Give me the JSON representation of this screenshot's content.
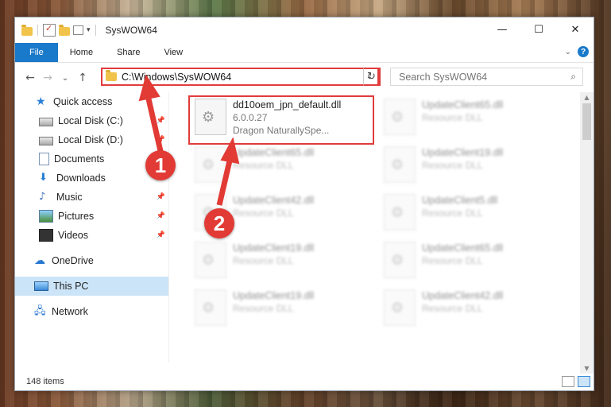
{
  "window": {
    "title": "SysWOW64",
    "controls": {
      "minimize": "—",
      "maximize": "☐",
      "close": "✕"
    }
  },
  "ribbon": {
    "tabs": [
      "File",
      "Home",
      "Share",
      "View"
    ],
    "help": "?"
  },
  "nav": {
    "back": "←",
    "forward": "→",
    "recent": "⌄",
    "up": "↑",
    "address": "C:\\Windows\\SysWOW64",
    "refresh": "↻",
    "search_placeholder": "Search SysWOW64"
  },
  "sidebar": {
    "items": [
      {
        "label": "Quick access",
        "icon": "star-icon",
        "pinned": false
      },
      {
        "label": "Local Disk (C:)",
        "icon": "disk-icon",
        "pinned": true
      },
      {
        "label": "Local Disk (D:)",
        "icon": "disk-icon",
        "pinned": true
      },
      {
        "label": "Documents",
        "icon": "documents-icon",
        "pinned": true
      },
      {
        "label": "Downloads",
        "icon": "download-icon",
        "pinned": true
      },
      {
        "label": "Music",
        "icon": "music-icon",
        "pinned": true
      },
      {
        "label": "Pictures",
        "icon": "pictures-icon",
        "pinned": true
      },
      {
        "label": "Videos",
        "icon": "videos-icon",
        "pinned": true
      },
      {
        "label": "OneDrive",
        "icon": "cloud-icon",
        "pinned": false
      },
      {
        "label": "This PC",
        "icon": "pc-icon",
        "pinned": false,
        "selected": true
      },
      {
        "label": "Network",
        "icon": "network-icon",
        "pinned": false
      }
    ]
  },
  "files": {
    "highlighted": {
      "name": "dd10oem_jpn_default.dll",
      "version": "6.0.0.27",
      "description": "Dragon NaturallySpe..."
    },
    "background_left": [
      {
        "name": "UpdateClient65.dll",
        "type": "Resource DLL"
      },
      {
        "name": "UpdateClient42.dll",
        "type": "Resource DLL"
      },
      {
        "name": "UpdateClient19.dll",
        "type": "Resource DLL"
      },
      {
        "name": "UpdateClient19.dll",
        "type": "Resource DLL"
      }
    ],
    "background_right": [
      {
        "name": "UpdateClient65.dll",
        "type": "Resource DLL"
      },
      {
        "name": "UpdateClient19.dll",
        "type": "Resource DLL"
      },
      {
        "name": "UpdateClient5.dll",
        "type": "Resource DLL"
      },
      {
        "name": "UpdateClient65.dll",
        "type": "Resource DLL"
      },
      {
        "name": "UpdateClient42.dll",
        "type": "Resource DLL"
      }
    ]
  },
  "status": {
    "count": "148 items"
  },
  "annotations": {
    "step1": "1",
    "step2": "2",
    "color": "#e23a35"
  }
}
